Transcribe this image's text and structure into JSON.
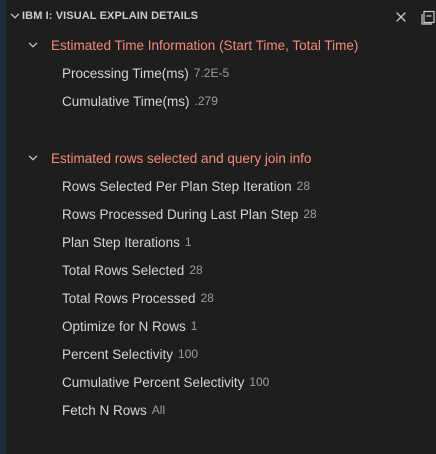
{
  "panel": {
    "title": "IBM I: VISUAL EXPLAIN DETAILS",
    "icons": {
      "header_chevron": "chevron-down-icon",
      "close": "close-icon",
      "collapse": "collapse-all-icon",
      "section_chevron": "chevron-down-icon"
    }
  },
  "sections": [
    {
      "title": "Estimated Time Information (Start Time, Total Time)",
      "items": [
        {
          "label": "Processing Time(ms)",
          "value": "7.2E-5"
        },
        {
          "label": "Cumulative Time(ms)",
          "value": ".279"
        }
      ]
    },
    {
      "title": "Estimated rows selected and query join info",
      "items": [
        {
          "label": "Rows Selected Per Plan Step Iteration",
          "value": "28"
        },
        {
          "label": "Rows Processed During Last Plan Step",
          "value": "28"
        },
        {
          "label": "Plan Step Iterations",
          "value": "1"
        },
        {
          "label": "Total Rows Selected",
          "value": "28"
        },
        {
          "label": "Total Rows Processed",
          "value": "28"
        },
        {
          "label": "Optimize for N Rows",
          "value": "1"
        },
        {
          "label": "Percent Selectivity",
          "value": "100"
        },
        {
          "label": "Cumulative Percent Selectivity",
          "value": "100"
        },
        {
          "label": "Fetch N Rows",
          "value": "All"
        }
      ]
    }
  ],
  "colors": {
    "background": "#1e1e1e",
    "section_title": "#f38a7a",
    "label": "#d4d4d4",
    "value": "#9d9d9d"
  }
}
